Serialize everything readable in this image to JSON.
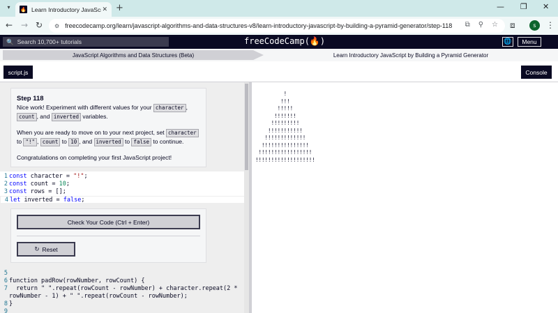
{
  "browser": {
    "tab_title": "Learn Introductory JavaScript b",
    "tab_favicon": "fcc-favicon-icon",
    "url": "freecodecamp.org/learn/javascript-algorithms-and-data-structures-v8/learn-introductory-javascript-by-building-a-pyramid-generator/step-118",
    "profile_initial": "s"
  },
  "nav": {
    "search_placeholder": "Search 10,700+ tutorials",
    "logo": "freeCodeCamp(🔥)",
    "menu_label": "Menu"
  },
  "breadcrumb": {
    "superblock": "JavaScript Algorithms and Data Structures (Beta)",
    "block": "Learn Introductory JavaScript by Building a Pyramid Generator"
  },
  "editor": {
    "file_tab": "script.js",
    "console_label": "Console"
  },
  "step": {
    "title": "Step 118",
    "p1_text1": "Nice work! Experiment with different values for your",
    "chip_character": "character",
    "p1_sep1": ",",
    "chip_count": "count",
    "p1_sep2": ", and",
    "chip_inverted": "inverted",
    "p1_text2": "variables.",
    "p2_text1": "When you are ready to move on to your next project, set",
    "chip_char_value": "\"!\"",
    "p2_sep1": ",",
    "p2_to1": "to",
    "chip_count2": "count",
    "p2_to2": "to",
    "chip_ten": "10",
    "p2_sep2": ", and",
    "chip_inverted2": "inverted",
    "p2_to3": "to",
    "chip_false": "false",
    "p2_text2": "to continue.",
    "p3": "Congratulations on completing your first JavaScript project!"
  },
  "code_top": [
    {
      "num": "1",
      "kw": "const",
      "rest": " character = ",
      "val": "\"!\"",
      "end": ";"
    },
    {
      "num": "2",
      "kw": "const",
      "rest": " count = ",
      "val": "10",
      "end": ";"
    },
    {
      "num": "3",
      "kw": "const",
      "rest": " rows = [];",
      "val": "",
      "end": ""
    },
    {
      "num": "4",
      "kw": "let",
      "rest": " inverted = ",
      "val": "false",
      "end": ";"
    }
  ],
  "buttons": {
    "check": "Check Your Code (Ctrl + Enter)",
    "reset": "Reset"
  },
  "code_bottom": {
    "l5": "5",
    "l6": "6",
    "l6_code": "function padRow(rowNumber, rowCount) {",
    "l7": "7",
    "l7_code": "  return \" \".repeat(rowCount - rowNumber) + character.repeat(2 *",
    "l7b_code": "rowNumber - 1) + \" \".repeat(rowCount - rowNumber);",
    "l8": "8",
    "l8_code": "}",
    "l9": "9"
  },
  "console_output": "         !\n        !!!\n       !!!!!\n      !!!!!!!\n     !!!!!!!!!\n    !!!!!!!!!!!\n   !!!!!!!!!!!!!\n  !!!!!!!!!!!!!!!\n !!!!!!!!!!!!!!!!!\n!!!!!!!!!!!!!!!!!!!"
}
